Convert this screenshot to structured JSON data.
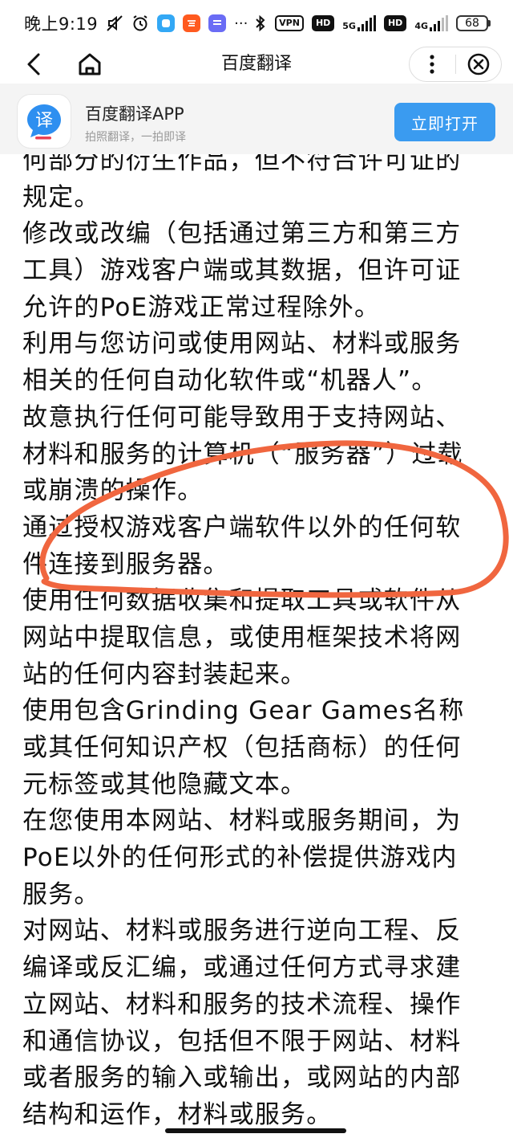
{
  "status_bar": {
    "time": "晚上9:19",
    "tag_vpn": "VPN",
    "tag_hd1": "HD",
    "net1": "5G",
    "tag_hd2": "HD",
    "net2": "4G",
    "battery": "68"
  },
  "nav": {
    "title": "百度翻译"
  },
  "banner": {
    "app_name": "百度翻译APP",
    "subtitle": "拍照翻译，一拍即译",
    "logo_glyph": "译",
    "open_label": "立即打开"
  },
  "content": {
    "lines": [
      "何部分的衍生作品，但不符合许可证的",
      "规定。",
      "修改或改编（包括通过第三方和第三方",
      "工具）游戏客户端或其数据，但许可证",
      "允许的PoE游戏正常过程除外。",
      "利用与您访问或使用网站、材料或服务",
      "相关的任何自动化软件或“机器人”。",
      "故意执行任何可能导致用于支持网站、",
      "材料和服务的计算机（“服务器”）过载",
      "或崩溃的操作。",
      "通过授权游戏客户端软件以外的任何软",
      "件连接到服务器。",
      "使用任何数据收集和提取工具或软件从",
      "网站中提取信息，或使用框架技术将网",
      "站的任何内容封装起来。",
      "使用包含Grinding Gear Games名称",
      "或其任何知识产权（包括商标）的任何",
      "元标签或其他隐藏文本。",
      "在您使用本网站、材料或服务期间，为",
      "PoE以外的任何形式的补偿提供游戏内",
      "服务。",
      "对网站、材料或服务进行逆向工程、反",
      "编译或反汇编，或通过任何方式寻求建",
      "立网站、材料和服务的技术流程、操作",
      "和通信协议，包括但不限于网站、材料",
      "或者服务的输入或输出，或网站的内部",
      "结构和运作，材料或服务。"
    ]
  },
  "colors": {
    "accent_button": "#3a9bf0",
    "annotation_stroke": "#f0663f",
    "banner_bg": "#f4f4f4"
  },
  "icons": {
    "back": "chevron-left-icon",
    "home": "home-icon",
    "more": "more-vertical-icon",
    "close": "close-circle-icon"
  }
}
